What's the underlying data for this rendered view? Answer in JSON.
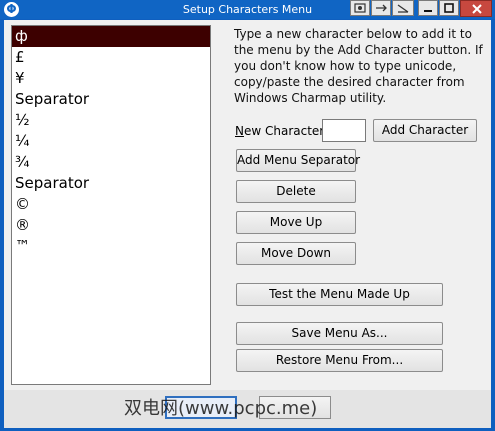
{
  "window": {
    "title": "Setup Characters Menu",
    "app_icon_glyph": "Φ"
  },
  "characters": [
    "ф",
    "£",
    "¥",
    "Separator",
    "½",
    "¼",
    "¾",
    "Separator",
    "©",
    "®",
    "™"
  ],
  "selected_index": 0,
  "instructions": "Type a new character below to add it to the menu by the Add Character button. If you don't know how to type unicode, copy/paste the desired character from Windows Charmap utility.",
  "new_character": {
    "label_prefix": "",
    "label_accel": "N",
    "label_rest": "ew Character:",
    "value": ""
  },
  "buttons": {
    "add_character": "Add Character",
    "add_menu_separator": "Add Menu Separator",
    "delete": "Delete",
    "move_up": "Move Up",
    "move_down": "Move Down",
    "test_menu": "Test the Menu Made Up",
    "save_menu_as": "Save Menu As...",
    "restore_menu_from": "Restore Menu From..."
  },
  "watermark": "双电网(www.pcpc.me)",
  "colors": {
    "title_bar": "#1065c4",
    "selected_item": "#3d0000",
    "close_button": "#c7483f"
  }
}
